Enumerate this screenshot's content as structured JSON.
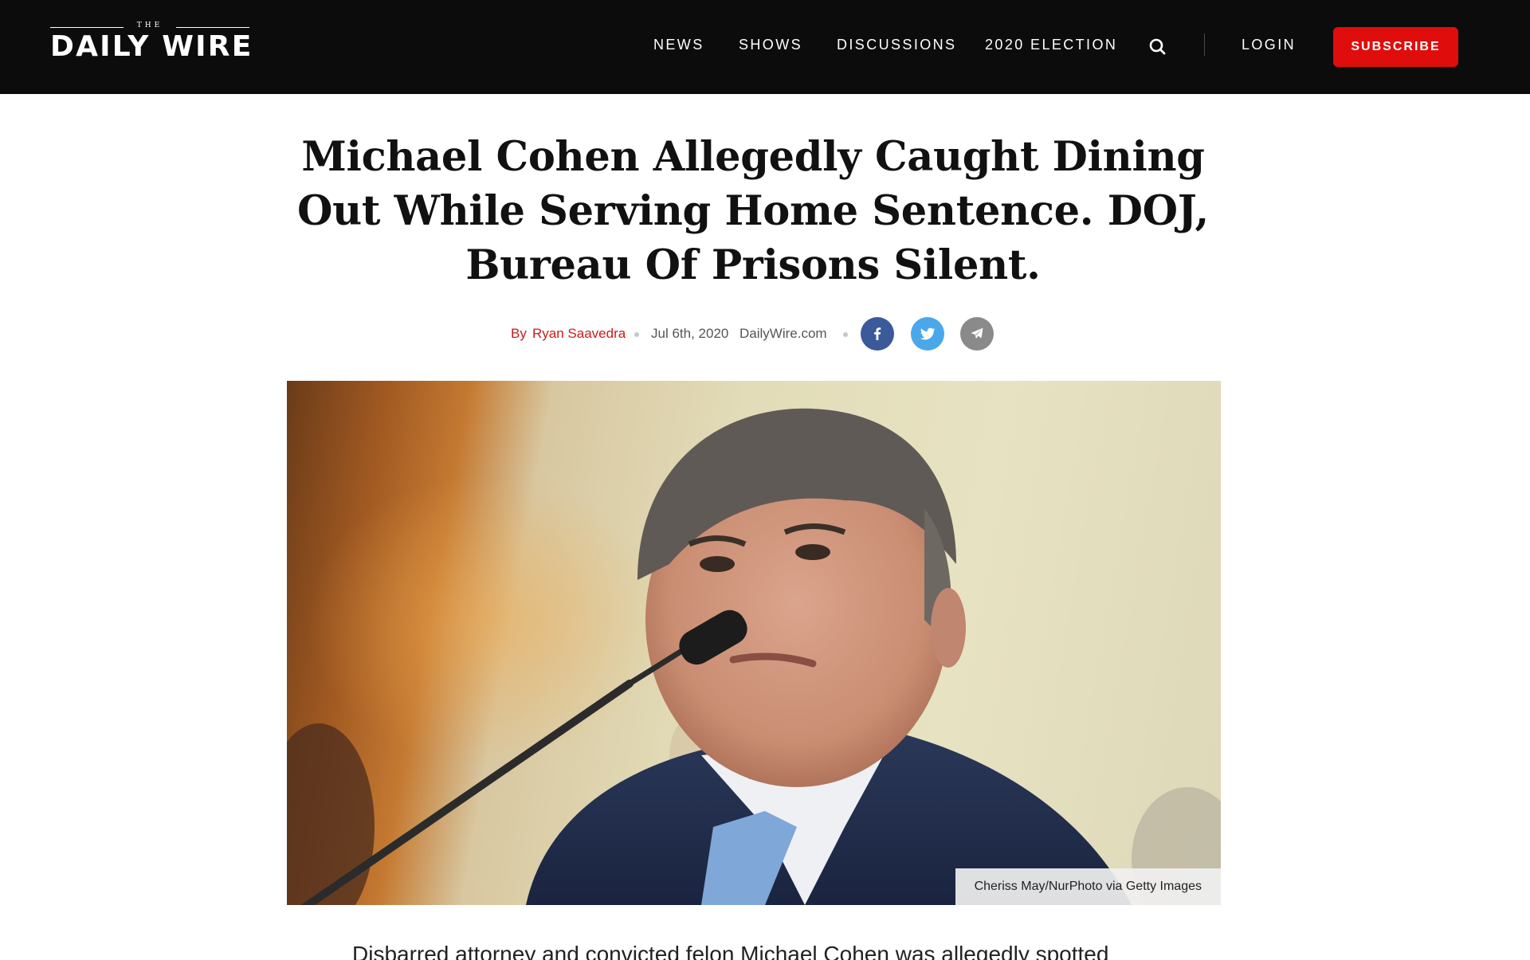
{
  "site": {
    "logo_the": "THE",
    "logo_name": "DAILY WIRE"
  },
  "nav": {
    "items": [
      {
        "label": "NEWS"
      },
      {
        "label": "SHOWS"
      },
      {
        "label": "DISCUSSIONS"
      },
      {
        "label": "2020 ELECTION"
      }
    ],
    "search_icon": "search-icon",
    "login_label": "LOGIN",
    "subscribe_label": "SUBSCRIBE"
  },
  "colors": {
    "header_bg": "#0c0c0c",
    "accent_red": "#e00d0d",
    "byline_red": "#cc1a1a",
    "facebook": "#3b5a9a",
    "twitter": "#4aa8ea",
    "email": "#8a8a8a"
  },
  "article": {
    "headline": "Michael Cohen Allegedly Caught Dining Out While Serving Home Sentence. DOJ, Bureau Of Prisons Silent.",
    "byline_prefix": "By",
    "author": "Ryan Saavedra",
    "date": "Jul 6th, 2020",
    "source": "DailyWire.com",
    "share_icons": [
      "facebook-icon",
      "twitter-icon",
      "email-send-icon"
    ],
    "image_caption": "Cheriss May/NurPhoto via Getty Images",
    "lead_text": "Disbarred attorney and convicted felon Michael Cohen was allegedly spotted"
  }
}
